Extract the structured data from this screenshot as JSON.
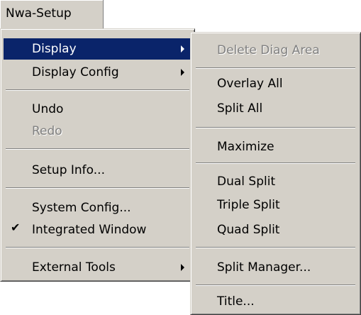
{
  "menubar": {
    "title": "Nwa-Setup"
  },
  "main_menu": {
    "items": [
      {
        "label": "Display",
        "submenu": true
      },
      {
        "label": "Display Config",
        "submenu": true
      },
      {
        "label": "Undo"
      },
      {
        "label": "Redo",
        "disabled": true
      },
      {
        "label": "Setup Info..."
      },
      {
        "label": "System Config..."
      },
      {
        "label": "Integrated Window",
        "checked": true
      },
      {
        "label": "External Tools",
        "submenu": true
      }
    ]
  },
  "display_submenu": {
    "items": [
      {
        "label": "Delete Diag Area",
        "disabled": true
      },
      {
        "label": "Overlay All"
      },
      {
        "label": "Split All"
      },
      {
        "label": "Maximize"
      },
      {
        "label": "Dual Split"
      },
      {
        "label": "Triple Split"
      },
      {
        "label": "Quad Split"
      },
      {
        "label": "Split Manager..."
      },
      {
        "label": "Title..."
      }
    ]
  },
  "icons": {
    "check": "✔"
  },
  "colors": {
    "menu_bg": "#d4d0c8",
    "highlight_bg": "#0a246a",
    "highlight_fg": "#ffffff",
    "disabled_fg": "#808080"
  }
}
